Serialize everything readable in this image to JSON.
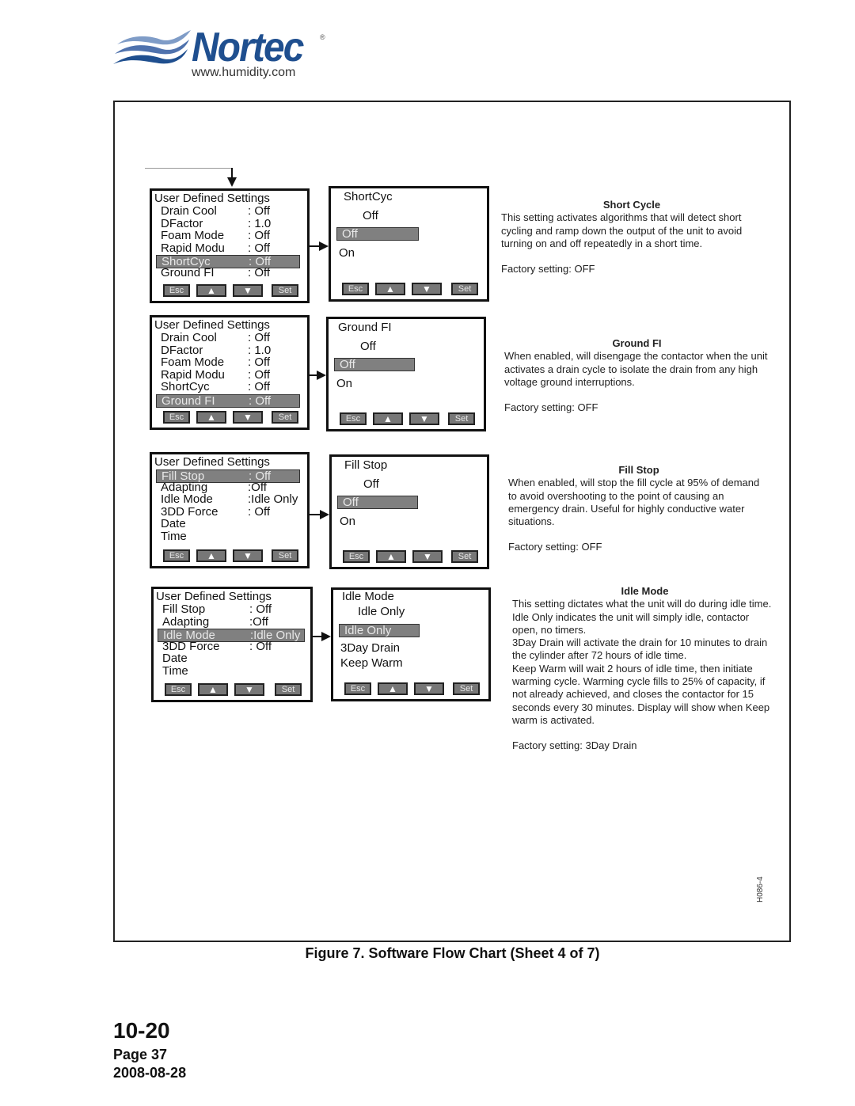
{
  "logo": {
    "brand": "Nortec",
    "registered": "®",
    "url": "www.humidity.com",
    "color": "#1f4f8f"
  },
  "rows": [
    {
      "menu": {
        "title": "User Defined Settings",
        "items": [
          {
            "label": "Drain Cool",
            "value": ": Off"
          },
          {
            "label": "DFactor",
            "value": ": 1.0"
          },
          {
            "label": "Foam Mode",
            "value": ": Off"
          },
          {
            "label": "Rapid Modu",
            "value": ": Off"
          },
          {
            "label": "ShortCyc",
            "value": ": Off",
            "selected": true
          },
          {
            "label": "Ground FI",
            "value": ": Off"
          }
        ]
      },
      "option": {
        "title": "ShortCyc",
        "current": "Off",
        "selected": "Off",
        "choices": [
          "On"
        ]
      },
      "description": {
        "title": "Short Cycle",
        "paragraphs": [
          "This setting activates algorithms that will detect short cycling and ramp down the output of the unit to avoid turning on and off repeatedly in a short time."
        ],
        "factory": "Factory setting: OFF"
      }
    },
    {
      "menu": {
        "title": "User Defined Settings",
        "items": [
          {
            "label": "Drain Cool",
            "value": ": Off"
          },
          {
            "label": "DFactor",
            "value": ": 1.0"
          },
          {
            "label": "Foam Mode",
            "value": ": Off"
          },
          {
            "label": "Rapid Modu",
            "value": ": Off"
          },
          {
            "label": "ShortCyc",
            "value": ": Off"
          },
          {
            "label": "Ground FI",
            "value": ": Off",
            "selected": true
          }
        ]
      },
      "option": {
        "title": "Ground FI",
        "current": "Off",
        "selected": "Off",
        "choices": [
          "On"
        ]
      },
      "description": {
        "title": "Ground FI",
        "paragraphs": [
          "When enabled, will disengage the contactor when the unit activates a drain cycle to isolate the drain from any high voltage ground interruptions."
        ],
        "factory": "Factory setting: OFF"
      }
    },
    {
      "menu": {
        "title": "User Defined Settings",
        "items": [
          {
            "label": "Fill Stop",
            "value": ": Off",
            "selected": true
          },
          {
            "label": "Adapting",
            "value": ":Off"
          },
          {
            "label": "Idle Mode",
            "value": ":Idle Only"
          },
          {
            "label": "3DD Force",
            "value": ": Off"
          },
          {
            "label": "Date",
            "value": ""
          },
          {
            "label": "Time",
            "value": ""
          }
        ]
      },
      "option": {
        "title": "Fill Stop",
        "current": "Off",
        "selected": "Off",
        "choices": [
          "On"
        ]
      },
      "description": {
        "title": "Fill Stop",
        "paragraphs": [
          "When enabled, will stop the fill cycle at 95% of demand to avoid overshooting to the point of causing an emergency drain.  Useful for highly conductive water situations."
        ],
        "factory": "Factory setting: OFF"
      }
    },
    {
      "menu": {
        "title": "User Defined Settings",
        "items": [
          {
            "label": "Fill Stop",
            "value": ": Off"
          },
          {
            "label": "Adapting",
            "value": ":Off"
          },
          {
            "label": "Idle Mode",
            "value": ":Idle Only",
            "selected": true
          },
          {
            "label": "3DD Force",
            "value": ": Off"
          },
          {
            "label": "Date",
            "value": ""
          },
          {
            "label": "Time",
            "value": ""
          }
        ]
      },
      "option": {
        "title": "Idle Mode",
        "current": "Idle Only",
        "selected": "Idle Only",
        "choices": [
          "3Day Drain",
          "Keep Warm"
        ]
      },
      "description": {
        "title": "Idle Mode",
        "paragraphs": [
          "This setting dictates what the unit will do during idle time.",
          "Idle Only indicates the unit will simply idle, contactor open, no timers.",
          "3Day Drain will activate the drain for 10 minutes to drain the cylinder after 72 hours of idle time.",
          "Keep Warm will wait 2 hours of idle time, then initiate warming cycle.  Warming cycle fills to 25% of capacity, if not already achieved,  and closes the contactor for 15 seconds every 30 minutes.  Display will show when Keep warm is activated."
        ],
        "factory": "Factory setting: 3Day Drain"
      }
    }
  ],
  "buttons": {
    "esc": "Esc",
    "up": "▲",
    "down": "▼",
    "set": "Set"
  },
  "drawing_code": "H086-4",
  "caption": "Figure 7.   Software Flow Chart (Sheet 4 of 7)",
  "footer": {
    "doc_number": "10-20",
    "page": "Page 37",
    "date": "2008-08-28"
  }
}
